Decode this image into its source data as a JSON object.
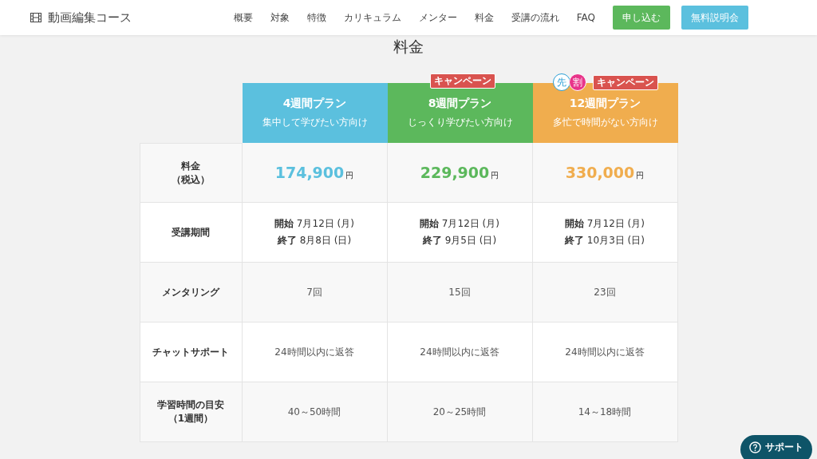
{
  "header": {
    "logo": "動画編集コース",
    "nav": [
      "概要",
      "対象",
      "特徴",
      "カリキュラム",
      "メンター",
      "料金",
      "受講の流れ",
      "FAQ"
    ],
    "buttons": [
      {
        "label": "申し込む",
        "kind": "apply"
      },
      {
        "label": "無料説明会",
        "kind": "info"
      }
    ]
  },
  "section_title": "料金",
  "plans": [
    {
      "name": "4週間プラン",
      "subtitle": "集中して学びたい方向け",
      "color": "#5bc0de"
    },
    {
      "name": "8週間プラン",
      "subtitle": "じっくり学びたい方向け",
      "color": "#5cb85c",
      "badges": [
        {
          "kind": "label",
          "text": "キャンペーン"
        }
      ]
    },
    {
      "name": "12週間プラン",
      "subtitle": "多忙で時間がない方向け",
      "color": "#f0ad4e",
      "badges": [
        {
          "kind": "outline",
          "text": "先"
        },
        {
          "kind": "filled",
          "text": "割"
        },
        {
          "kind": "label",
          "text": "キャンペーン"
        }
      ]
    }
  ],
  "rows": [
    {
      "label": [
        "料金",
        "（税込）"
      ],
      "cells": [
        {
          "kind": "price",
          "amount": "174,900",
          "unit": "円"
        },
        {
          "kind": "price",
          "amount": "229,900",
          "unit": "円"
        },
        {
          "kind": "price",
          "amount": "330,000",
          "unit": "円"
        }
      ]
    },
    {
      "label": [
        "受講期間"
      ],
      "cells": [
        {
          "kind": "period",
          "lines": [
            {
              "head": "開始",
              "text": "7月12日 (月)"
            },
            {
              "head": "終了",
              "text": "8月8日 (日)"
            }
          ]
        },
        {
          "kind": "period",
          "lines": [
            {
              "head": "開始",
              "text": "7月12日 (月)"
            },
            {
              "head": "終了",
              "text": "9月5日 (日)"
            }
          ]
        },
        {
          "kind": "period",
          "lines": [
            {
              "head": "開始",
              "text": "7月12日 (月)"
            },
            {
              "head": "終了",
              "text": "10月3日 (日)"
            }
          ]
        }
      ]
    },
    {
      "label": [
        "メンタリング"
      ],
      "cells": [
        {
          "kind": "text",
          "text": "7回"
        },
        {
          "kind": "text",
          "text": "15回"
        },
        {
          "kind": "text",
          "text": "23回"
        }
      ]
    },
    {
      "label": [
        "チャットサポート"
      ],
      "cells": [
        {
          "kind": "text",
          "text": "24時間以内に返答"
        },
        {
          "kind": "text",
          "text": "24時間以内に返答"
        },
        {
          "kind": "text",
          "text": "24時間以内に返答"
        }
      ]
    },
    {
      "label": [
        "学習時間の目安",
        "（1週間）"
      ],
      "cells": [
        {
          "kind": "text",
          "text": "40～50時間"
        },
        {
          "kind": "text",
          "text": "20～25時間"
        },
        {
          "kind": "text",
          "text": "14～18時間"
        }
      ]
    }
  ],
  "support_button": {
    "label": "サポート"
  }
}
